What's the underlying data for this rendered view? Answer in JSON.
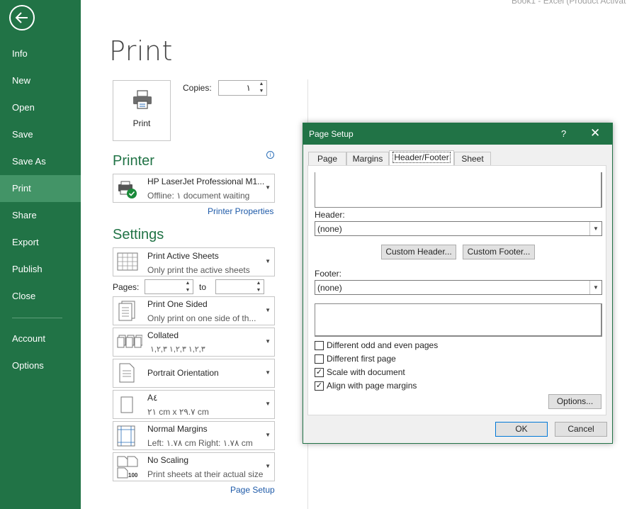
{
  "window": {
    "title_text": "Book1 - Excel (Product Activat"
  },
  "sidebar": {
    "back_label": "",
    "items": [
      {
        "label": "Info"
      },
      {
        "label": "New"
      },
      {
        "label": "Open"
      },
      {
        "label": "Save"
      },
      {
        "label": "Save As"
      },
      {
        "label": "Print"
      },
      {
        "label": "Share"
      },
      {
        "label": "Export"
      },
      {
        "label": "Publish"
      },
      {
        "label": "Close"
      },
      {
        "label": "Account"
      },
      {
        "label": "Options"
      }
    ],
    "active": "Print"
  },
  "print": {
    "title": "Print",
    "button_label": "Print",
    "copies_label": "Copies:",
    "copies_value": "١"
  },
  "printer": {
    "heading": "Printer",
    "name": "HP LaserJet Professional M1...",
    "status": "Offline: ١ document waiting",
    "properties_link": "Printer Properties"
  },
  "settings": {
    "heading": "Settings",
    "what": {
      "l1": "Print Active Sheets",
      "l2": "Only print the active sheets"
    },
    "pages_label": "Pages:",
    "to_label": "to",
    "sides": {
      "l1": "Print One Sided",
      "l2": "Only print on one side of th..."
    },
    "collation": {
      "l1": "Collated",
      "l2": "١,٢,٣    ١,٢,٣    ١,٢,٣"
    },
    "orientation": {
      "l1": "Portrait Orientation"
    },
    "paper": {
      "l1": "A٤",
      "l2": "٢١ cm x ٢٩.٧ cm"
    },
    "margins": {
      "l1": "Normal Margins",
      "l2": "Left:  ١.٧٨ cm    Right:  ١.٧٨ cm"
    },
    "scaling": {
      "l1": "No Scaling",
      "l2": "Print sheets at their actual size"
    },
    "page_setup_link": "Page Setup"
  },
  "dialog": {
    "title": "Page Setup",
    "help": "?",
    "close": "✕",
    "tabs": [
      {
        "label": "Page"
      },
      {
        "label": "Margins"
      },
      {
        "label": "Header/Footer"
      },
      {
        "label": "Sheet"
      }
    ],
    "active_tab": "Header/Footer",
    "header_label": "Header:",
    "header_value": "(none)",
    "custom_header": "Custom Header...",
    "custom_footer": "Custom Footer...",
    "footer_label": "Footer:",
    "footer_value": "(none)",
    "checkboxes": [
      {
        "label": "Different odd and even pages",
        "checked": false
      },
      {
        "label": "Different first page",
        "checked": false
      },
      {
        "label": "Scale with document",
        "checked": true
      },
      {
        "label": "Align with page margins",
        "checked": true
      }
    ],
    "options_button": "Options...",
    "ok_button": "OK",
    "cancel_button": "Cancel"
  },
  "colors": {
    "brand": "#217346",
    "link": "#1e5aa8"
  }
}
